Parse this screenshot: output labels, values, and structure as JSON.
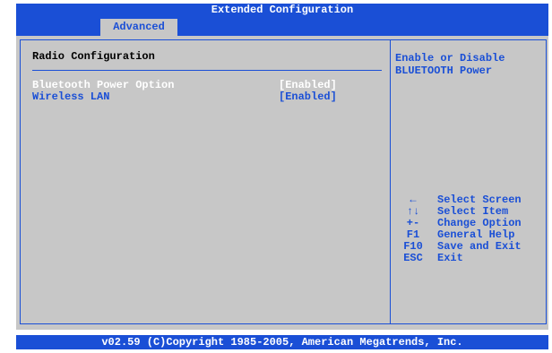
{
  "header": {
    "title": "Extended Configuration"
  },
  "tabs": [
    {
      "label": "Advanced"
    }
  ],
  "panel": {
    "section_title": "Radio Configuration",
    "items": [
      {
        "label": "Bluetooth Power Option",
        "value": "[Enabled]",
        "selected": true
      },
      {
        "label": "Wireless LAN",
        "value": "[Enabled]",
        "selected": false
      }
    ]
  },
  "help": {
    "text": "Enable or Disable BLUETOOTH Power"
  },
  "keys": [
    {
      "key": "←",
      "desc": "Select Screen"
    },
    {
      "key": "↑↓",
      "desc": "Select Item"
    },
    {
      "key": "+-",
      "desc": "Change Option"
    },
    {
      "key": "F1",
      "desc": "General Help"
    },
    {
      "key": "F10",
      "desc": "Save and Exit"
    },
    {
      "key": "ESC",
      "desc": "Exit"
    }
  ],
  "footer": {
    "text": "v02.59 (C)Copyright 1985-2005, American Megatrends, Inc."
  },
  "colors": {
    "bios_blue": "#1a4fd6",
    "panel_gray": "#c7c7c7"
  }
}
